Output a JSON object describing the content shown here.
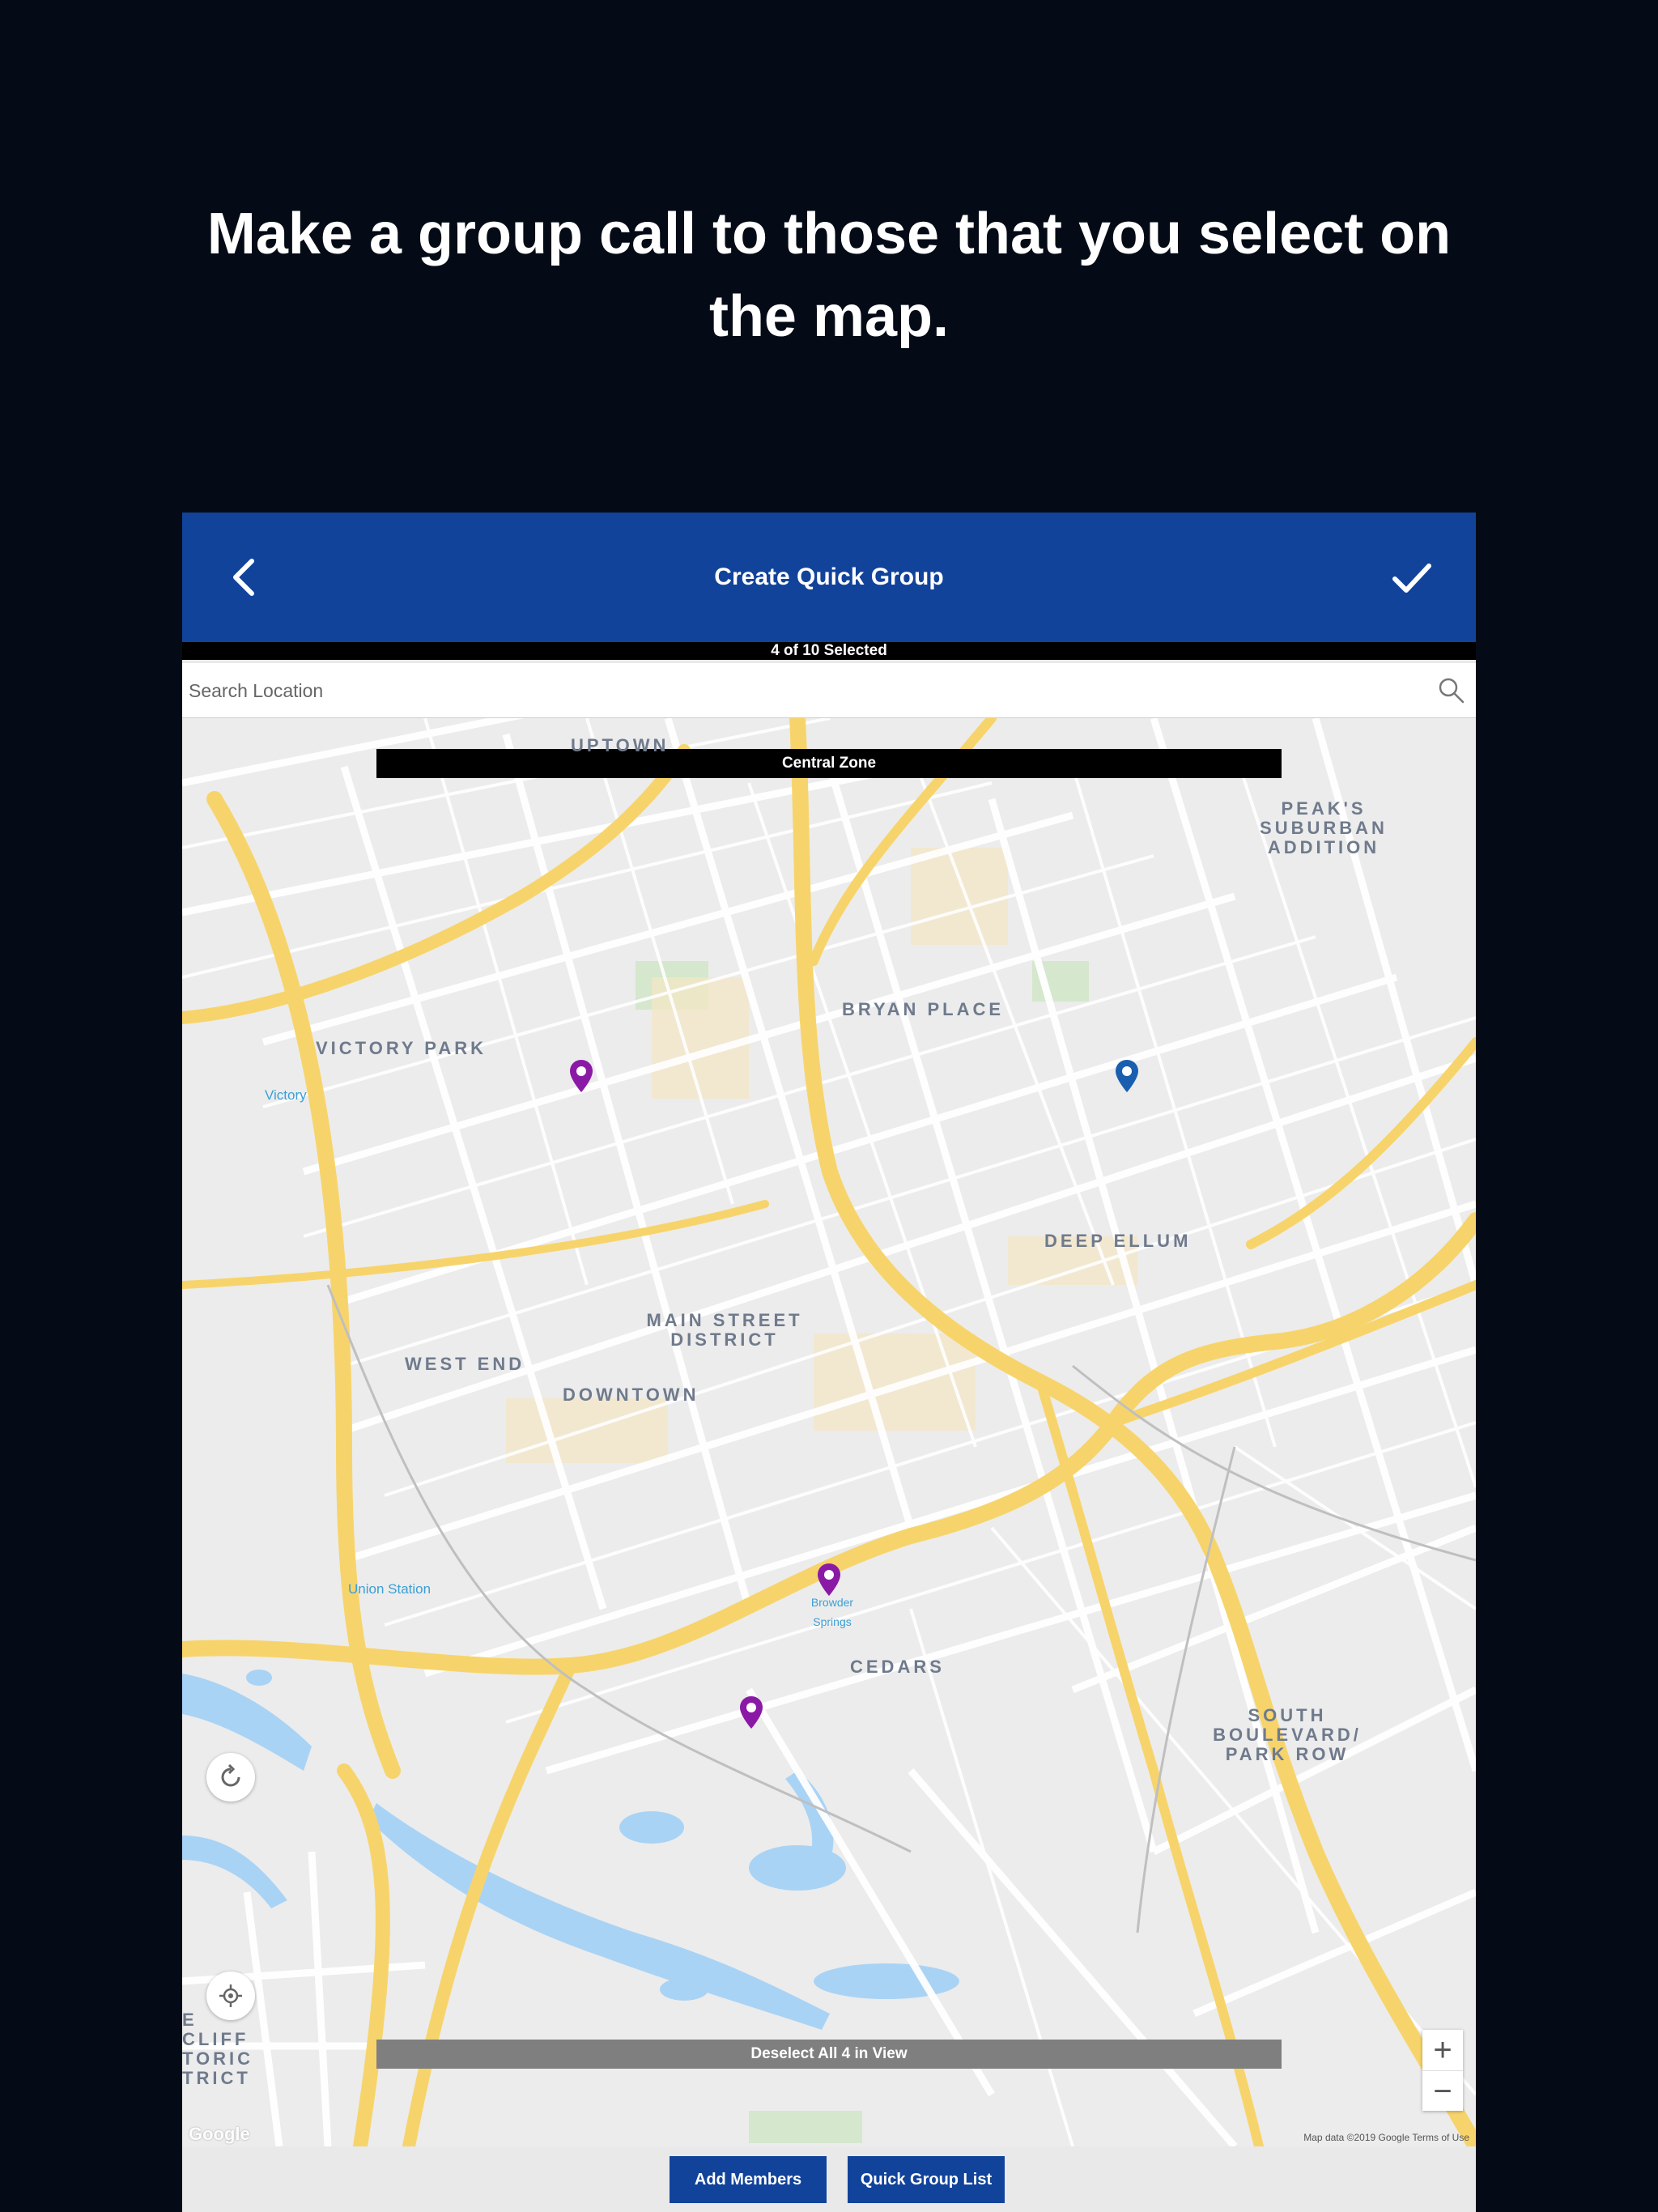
{
  "headline": "Make a group call to those that you select on the map.",
  "app_bar": {
    "title": "Create Quick Group",
    "back_icon": "chevron-left-icon",
    "confirm_icon": "checkmark-icon"
  },
  "selection_status": "4 of 10 Selected",
  "search": {
    "placeholder": "Search Location",
    "icon": "search-icon"
  },
  "map": {
    "zone_label": "Central Zone",
    "deselect_label": "Deselect All 4 in View",
    "neighborhoods": {
      "uptown": "UPTOWN",
      "peaks": "PEAK'S SUBURBAN ADDITION",
      "bryan_place": "BRYAN PLACE",
      "victory_park": "VICTORY PARK",
      "deep_ellum": "DEEP ELLUM",
      "main_street": "MAIN STREET DISTRICT",
      "west_end": "WEST END",
      "downtown": "DOWNTOWN",
      "cedars": "CEDARS",
      "south_boulevard": "SOUTH BOULEVARD/ PARK ROW",
      "cliff": "E CLIFF TORIC TRICT"
    },
    "pois": {
      "victory": "Victory",
      "union_station": "Union Station",
      "browder": "Browder Springs"
    },
    "attribution": "Map data ©2019 Google   Terms of Use",
    "logo": "Google",
    "zoom_in": "+",
    "zoom_out": "−",
    "refresh_icon": "refresh-icon",
    "locate_icon": "my-location-icon",
    "pins": [
      {
        "name": "member-pin-1",
        "color": "#8a1aa6"
      },
      {
        "name": "member-pin-2",
        "color": "#1a5eb0"
      },
      {
        "name": "member-pin-3",
        "color": "#8a1aa6"
      },
      {
        "name": "member-pin-4",
        "color": "#8a1aa6"
      }
    ]
  },
  "actions": {
    "add_members": "Add Members",
    "quick_group_list": "Quick Group List"
  },
  "colors": {
    "brand_blue": "#11439b",
    "background": "#050b16",
    "highway": "#f7d46b",
    "water": "#a9d3f5"
  }
}
